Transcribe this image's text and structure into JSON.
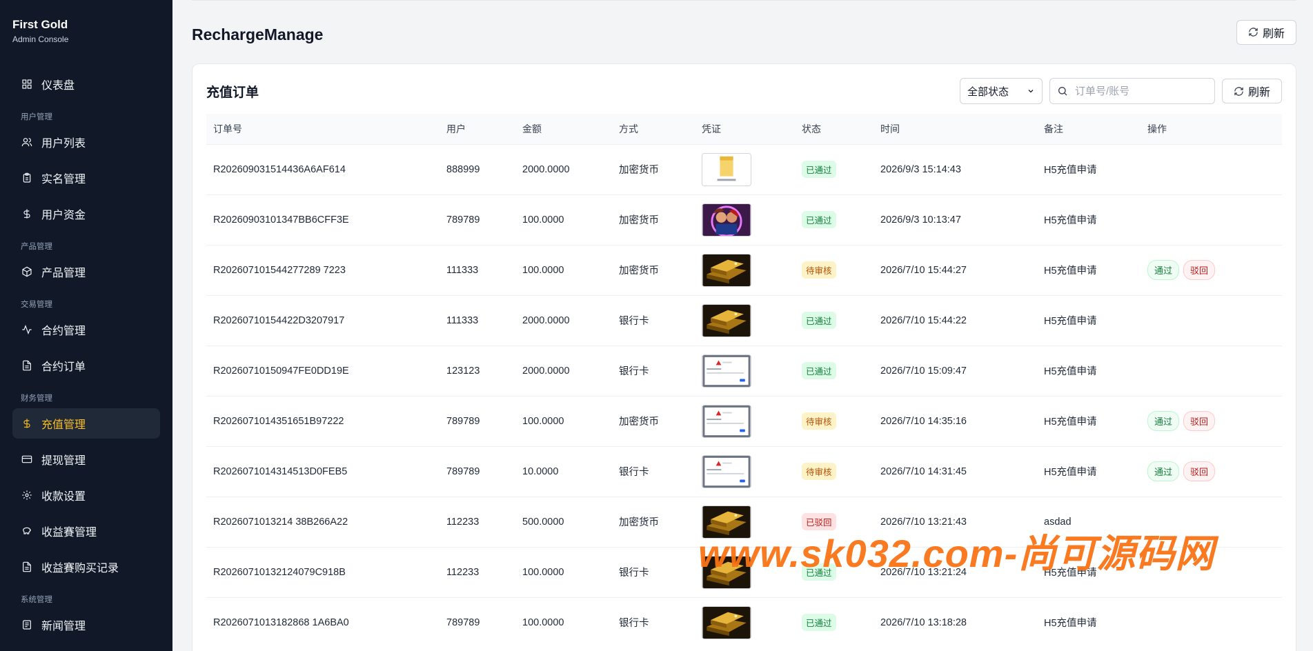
{
  "brand": {
    "title": "First Gold",
    "subtitle": "Admin Console"
  },
  "sidebar": {
    "dashboard": "仪表盘",
    "sections": {
      "users": "用户管理",
      "products": "产品管理",
      "trade": "交易管理",
      "finance": "财务管理",
      "system": "系统管理"
    },
    "items": {
      "user_list": "用户列表",
      "kyc": "实名管理",
      "user_funds": "用户资金",
      "product_manage": "产品管理",
      "contract_manage": "合约管理",
      "contract_orders": "合约订单",
      "recharge_manage": "充值管理",
      "withdraw_manage": "提现管理",
      "payment_settings": "收款设置",
      "yield_manage": "收益賽管理",
      "yield_records": "收益賽购买记录",
      "news_manage": "新闻管理"
    }
  },
  "header": {
    "title": "RechargeManage",
    "refresh_label": "刷新"
  },
  "card": {
    "title": "充值订单",
    "status_filter": "全部状态",
    "search_placeholder": "订单号/账号",
    "refresh_label": "刷新"
  },
  "table": {
    "columns": [
      "订单号",
      "用户",
      "金额",
      "方式",
      "凭证",
      "状态",
      "时间",
      "备注",
      "操作"
    ],
    "rows": [
      {
        "order": "R202609031514436A6AF614",
        "user": "888999",
        "amount": "2000.0000",
        "method": "加密货币",
        "proof": "folder",
        "status": "已通过",
        "status_type": "approved",
        "time": "2026/9/3 15:14:43",
        "note": "H5充值申请",
        "actions": false
      },
      {
        "order": "R20260903101347BB6CFF3E",
        "user": "789789",
        "amount": "100.0000",
        "method": "加密货币",
        "proof": "couple",
        "status": "已通过",
        "status_type": "approved",
        "time": "2026/9/3 10:13:47",
        "note": "H5充值申请",
        "actions": false
      },
      {
        "order": "R202607101544277289 7223",
        "user": "111333",
        "amount": "100.0000",
        "method": "加密货币",
        "proof": "gold",
        "status": "待审核",
        "status_type": "pending",
        "time": "2026/7/10 15:44:27",
        "note": "H5充值申请",
        "actions": true
      },
      {
        "order": "R20260710154422D3207917",
        "user": "111333",
        "amount": "2000.0000",
        "method": "银行卡",
        "proof": "gold",
        "status": "已通过",
        "status_type": "approved",
        "time": "2026/7/10 15:44:22",
        "note": "H5充值申请",
        "actions": false
      },
      {
        "order": "R20260710150947FE0DD19E",
        "user": "123123",
        "amount": "2000.0000",
        "method": "银行卡",
        "proof": "dialog",
        "status": "已通过",
        "status_type": "approved",
        "time": "2026/7/10 15:09:47",
        "note": "H5充值申请",
        "actions": false
      },
      {
        "order": "R2026071014351651B97222",
        "user": "789789",
        "amount": "100.0000",
        "method": "加密货币",
        "proof": "dialog",
        "status": "待审核",
        "status_type": "pending",
        "time": "2026/7/10 14:35:16",
        "note": "H5充值申请",
        "actions": true
      },
      {
        "order": "R2026071014314513D0FEB5",
        "user": "789789",
        "amount": "10.0000",
        "method": "银行卡",
        "proof": "dialog",
        "status": "待审核",
        "status_type": "pending",
        "time": "2026/7/10 14:31:45",
        "note": "H5充值申请",
        "actions": true
      },
      {
        "order": "R2026071013214 38B266A22",
        "user": "112233",
        "amount": "500.0000",
        "method": "加密货币",
        "proof": "gold",
        "status": "已驳回",
        "status_type": "rejected",
        "time": "2026/7/10 13:21:43",
        "note": "asdad",
        "actions": false
      },
      {
        "order": "R20260710132124079C918B",
        "user": "112233",
        "amount": "100.0000",
        "method": "银行卡",
        "proof": "gold",
        "status": "已通过",
        "status_type": "approved",
        "time": "2026/7/10 13:21:24",
        "note": "H5充值申请",
        "actions": false
      },
      {
        "order": "R2026071013182868 1A6BA0",
        "user": "789789",
        "amount": "100.0000",
        "method": "银行卡",
        "proof": "gold",
        "status": "已通过",
        "status_type": "approved",
        "time": "2026/7/10 13:18:28",
        "note": "H5充值申请",
        "actions": false
      }
    ],
    "action_labels": {
      "pass": "通过",
      "reject": "驳回"
    }
  },
  "watermark": "www.sk032.com-尚可源码网",
  "colors": {
    "sidebar_bg": "#111827",
    "active_accent": "#fbbf24",
    "approved": "#15803d",
    "pending": "#b45309",
    "rejected": "#b91c1c",
    "watermark": "#f97316"
  }
}
